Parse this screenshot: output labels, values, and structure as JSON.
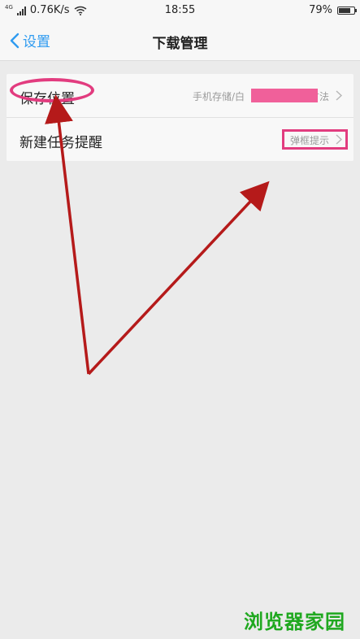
{
  "status_bar": {
    "network_type": "4G",
    "speed": "0.76K/s",
    "time": "18:55",
    "battery": "79%",
    "battery_level": 0.79
  },
  "nav": {
    "back_label": "设置",
    "title": "下载管理"
  },
  "settings": {
    "save_location": {
      "label": "保存位置",
      "value_start": "手机存储/白",
      "value_end": "方法"
    },
    "new_task_alert": {
      "label": "新建任务提醒",
      "value": "弹框提示"
    }
  },
  "watermark": "浏览器家园",
  "colors": {
    "accent": "#2f9bf0",
    "annotation_pink": "#e23c7f",
    "redaction": "#f0609a",
    "arrow_red": "#b51a1a",
    "watermark_green": "#1fa81f"
  },
  "icons": {
    "back": "chevron-left-icon",
    "row_chevron": "chevron-right-icon",
    "wifi": "wifi-icon",
    "signal": "signal-icon",
    "battery": "battery-icon"
  }
}
